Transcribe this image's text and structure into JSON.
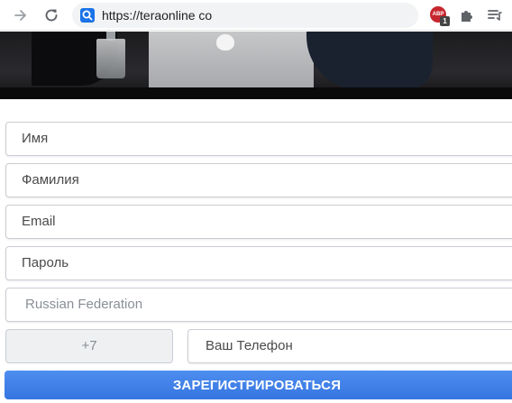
{
  "browser": {
    "url": "https://teraonline co",
    "extension_badge": "1",
    "abp_label": "ABP",
    "icons": [
      "forward-arrow-icon",
      "reload-icon",
      "search-engine-icon",
      "adblock-icon",
      "puzzle-extensions-icon",
      "reading-list-icon"
    ]
  },
  "form": {
    "first_name_placeholder": "Имя",
    "last_name_placeholder": "Фамилия",
    "email_placeholder": "Email",
    "password_placeholder": "Пароль",
    "country_value": "Russian Federation",
    "phone_code_value": "+7",
    "phone_placeholder": "Ваш Телефон",
    "submit_label": "ЗАРЕГИСТРИРОВАТЬСЯ"
  },
  "colors": {
    "accent": "#3b7ee6",
    "field_border": "#c9cdd3",
    "code_bg": "#eef0f2"
  }
}
